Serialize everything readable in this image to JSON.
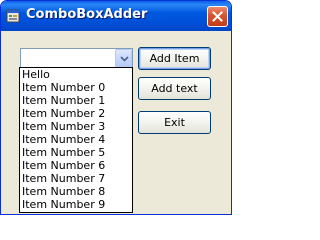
{
  "window": {
    "title": "ComboBoxAdder",
    "icons": {
      "app": "app-window-icon",
      "close": "close-icon",
      "dropdown": "chevron-down-icon"
    },
    "colors": {
      "titlebar": "#0058e0",
      "client": "#ece9d8",
      "close": "#d9542f"
    }
  },
  "combo": {
    "value": "",
    "items": [
      "Hello",
      "Item Number 0",
      "Item Number 1",
      "Item Number 2",
      "Item Number 3",
      "Item Number 4",
      "Item Number 5",
      "Item Number 6",
      "Item Number 7",
      "Item Number 8",
      "Item Number 9"
    ]
  },
  "buttons": {
    "add_item": "Add Item",
    "add_text": "Add text",
    "exit": "Exit"
  }
}
